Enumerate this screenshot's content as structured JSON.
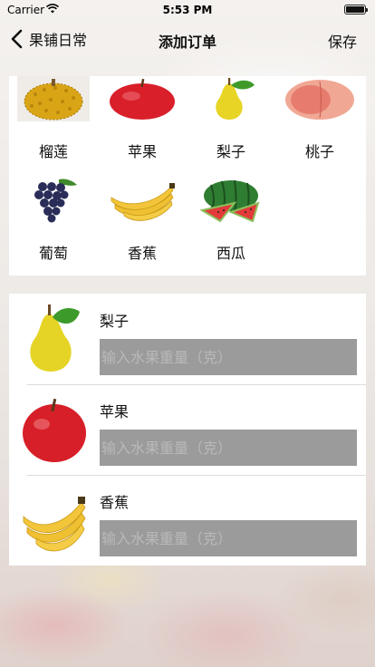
{
  "status_bar": {
    "carrier": "Carrier",
    "time": "5:53 PM",
    "icons": [
      "wifi-icon",
      "battery-icon"
    ]
  },
  "nav": {
    "back_label": "果铺日常",
    "title": "添加订单",
    "save_label": "保存"
  },
  "fruit_picker": [
    {
      "name": "榴莲",
      "icon": "durian-icon"
    },
    {
      "name": "苹果",
      "icon": "apple-icon"
    },
    {
      "name": "梨子",
      "icon": "pear-icon"
    },
    {
      "name": "桃子",
      "icon": "peach-icon"
    },
    {
      "name": "葡萄",
      "icon": "grape-icon"
    },
    {
      "name": "香蕉",
      "icon": "banana-icon"
    },
    {
      "name": "西瓜",
      "icon": "watermelon-icon"
    }
  ],
  "order_items": [
    {
      "name": "梨子",
      "icon": "pear-icon",
      "weight_value": "",
      "weight_placeholder": "输入水果重量（克）"
    },
    {
      "name": "苹果",
      "icon": "apple-icon",
      "weight_value": "",
      "weight_placeholder": "输入水果重量（克）"
    },
    {
      "name": "香蕉",
      "icon": "banana-icon",
      "weight_value": "",
      "weight_placeholder": "输入水果重量（克）"
    }
  ],
  "colors": {
    "input_bg": "#9b9b9b",
    "card_bg": "#ffffff"
  }
}
